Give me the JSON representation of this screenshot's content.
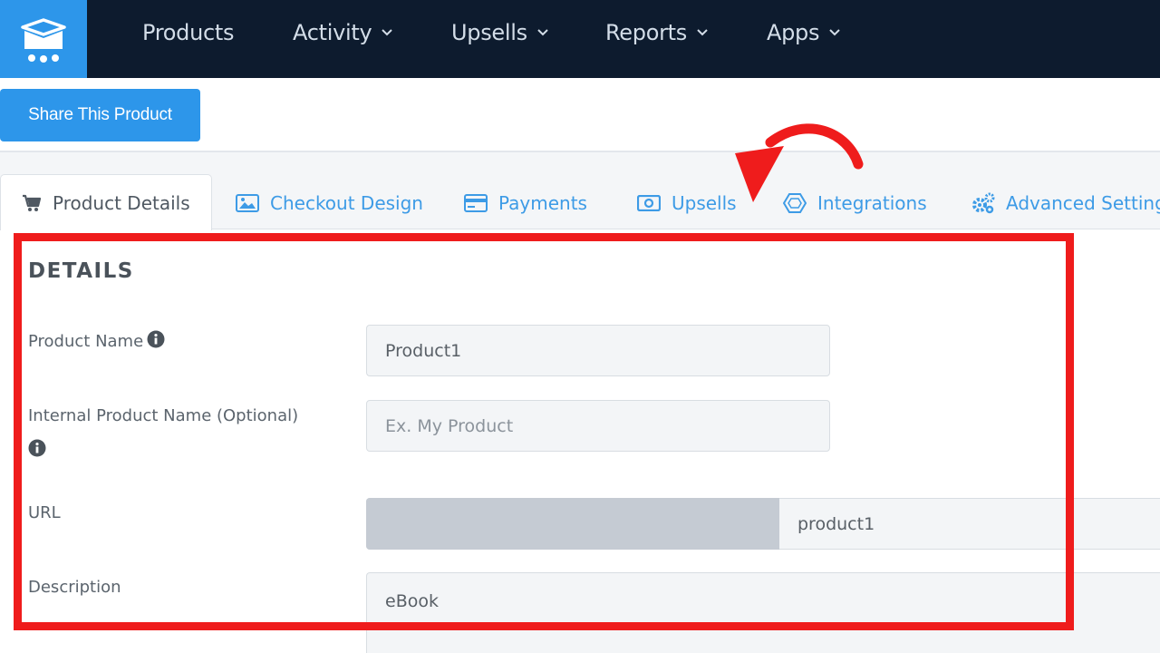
{
  "nav": {
    "logo_icon": "shopping-cart-box-icon",
    "items": [
      {
        "label": "Products",
        "has_dropdown": false
      },
      {
        "label": "Activity",
        "has_dropdown": true
      },
      {
        "label": "Upsells",
        "has_dropdown": true
      },
      {
        "label": "Reports",
        "has_dropdown": true
      },
      {
        "label": "Apps",
        "has_dropdown": true
      }
    ]
  },
  "share_button": {
    "label": "Share This Product"
  },
  "tabs": [
    {
      "label": "Product Details",
      "icon": "cart-icon",
      "active": true
    },
    {
      "label": "Checkout Design",
      "icon": "image-icon",
      "active": false
    },
    {
      "label": "Payments",
      "icon": "credit-card-icon",
      "active": false
    },
    {
      "label": "Upsells",
      "icon": "money-icon",
      "active": false
    },
    {
      "label": "Integrations",
      "icon": "hexagon-icon",
      "active": false
    },
    {
      "label": "Advanced Setting",
      "icon": "gears-icon",
      "active": false
    }
  ],
  "details": {
    "title": "DETAILS",
    "product_name": {
      "label": "Product Name",
      "value": "Product1"
    },
    "internal_name": {
      "label": "Internal Product Name (Optional)",
      "placeholder": "Ex. My Product"
    },
    "url": {
      "label": "URL",
      "value": "product1"
    },
    "description": {
      "label": "Description",
      "value": "eBook"
    }
  },
  "colors": {
    "nav_bg": "#0d1b2e",
    "brand_blue": "#2d96ea",
    "tab_link": "#3d9be6",
    "annotation_red": "#ef1c1c"
  }
}
